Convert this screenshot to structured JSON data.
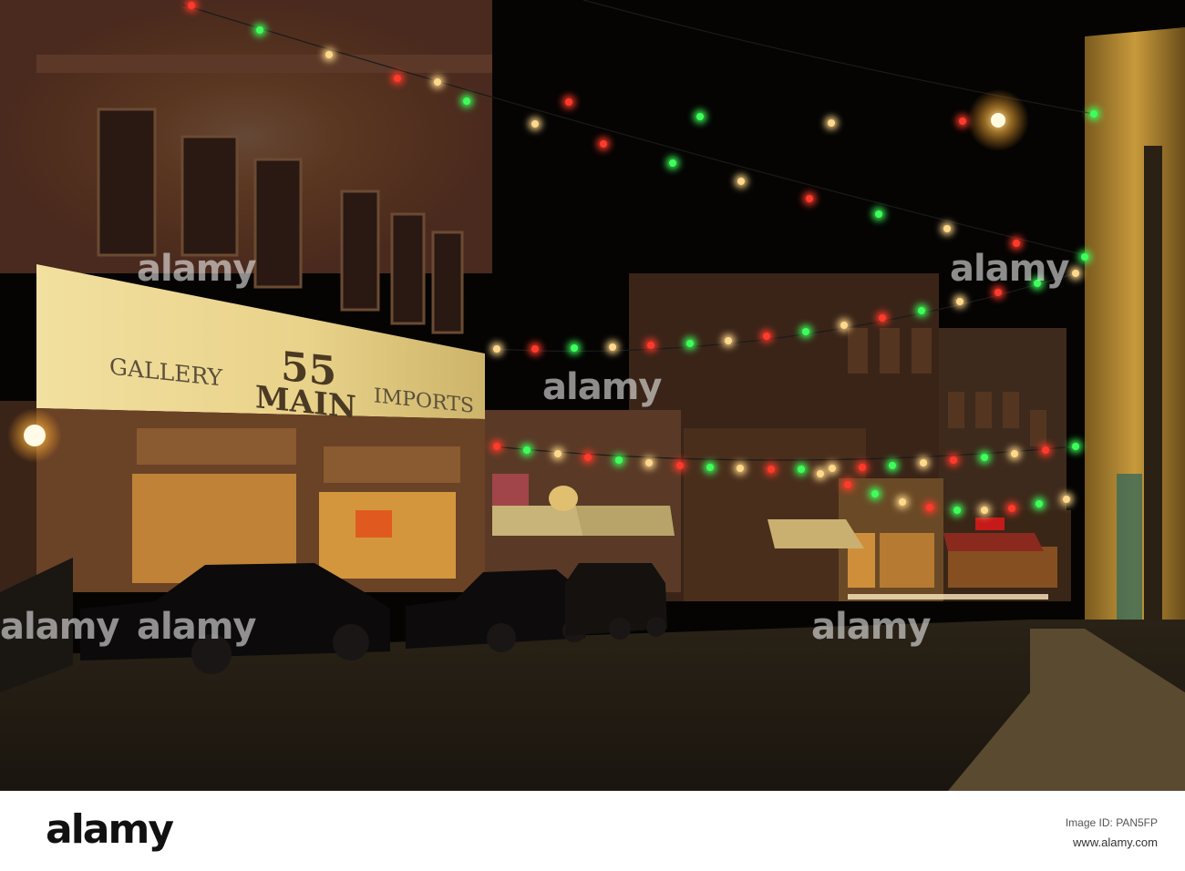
{
  "photo": {
    "sign_left": "GALLERY",
    "sign_right": "IMPORTS",
    "sign_number": "55",
    "sign_word": "MAIN"
  },
  "watermark": {
    "text": "alamy"
  },
  "footer": {
    "logo": "alamy",
    "image_id_label": "Image ID: PAN5FP",
    "site": "www.alamy.com"
  },
  "colors": {
    "sky": "#050403",
    "light_red": "#ff3a2a",
    "light_green": "#3dff5a",
    "light_warm": "#ffd88a",
    "storefront_glow": "#f0b54a"
  }
}
